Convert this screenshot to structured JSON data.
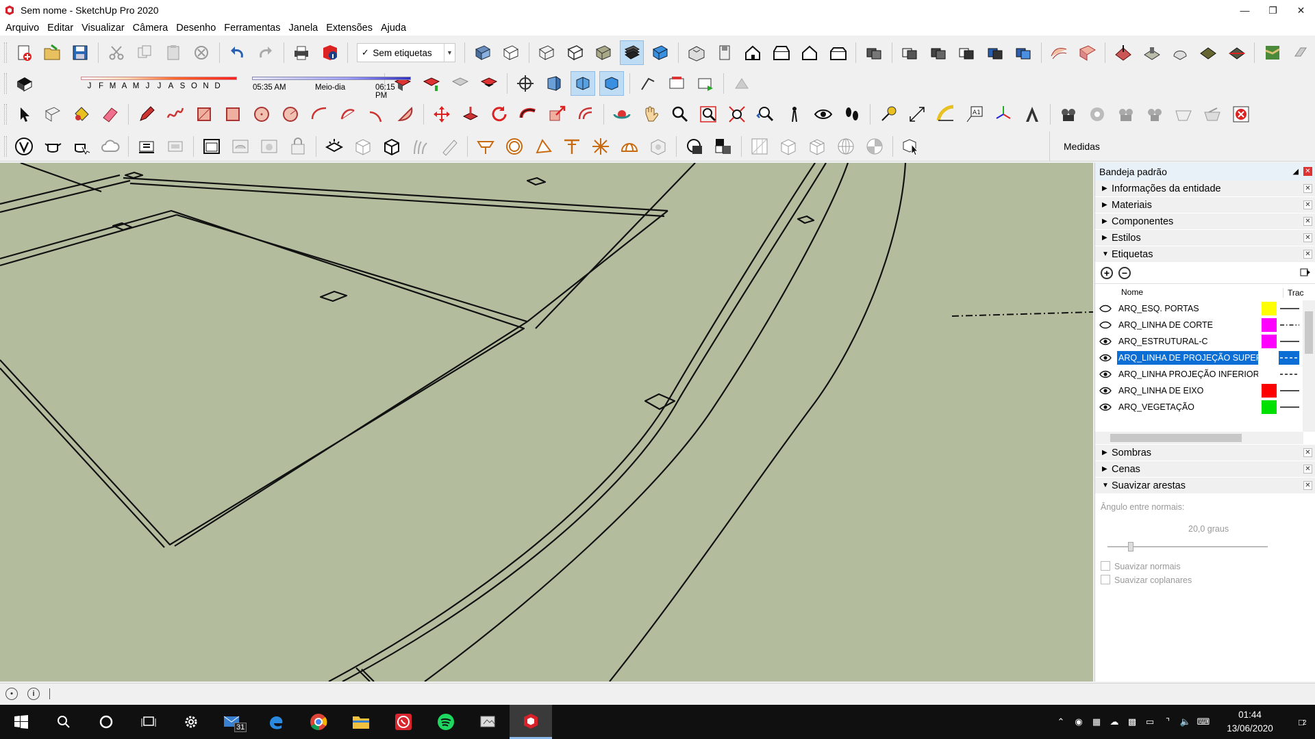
{
  "window": {
    "title": "Sem nome - SketchUp Pro 2020",
    "controls": [
      "minimize",
      "restore",
      "close"
    ]
  },
  "menu": [
    "Arquivo",
    "Editar",
    "Visualizar",
    "Câmera",
    "Desenho",
    "Ferramentas",
    "Janela",
    "Extensões",
    "Ajuda"
  ],
  "toolbar": {
    "tag_select": "Sem etiquetas",
    "months": [
      "J",
      "F",
      "M",
      "A",
      "M",
      "J",
      "J",
      "A",
      "S",
      "O",
      "N",
      "D"
    ],
    "time_start": "05:35 AM",
    "time_mid": "Meio-dia",
    "time_end": "06:15 PM",
    "measures_label": "Medidas"
  },
  "tray": {
    "title": "Bandeja padrão",
    "panels_top": [
      "Informações da entidade",
      "Materiais",
      "Componentes",
      "Estilos",
      "Etiquetas"
    ],
    "tags_header": {
      "name": "Nome",
      "dash": "Trac"
    },
    "tags": [
      {
        "name": "ARQ_ESQ. PORTAS",
        "visible": false,
        "color": "#ffff00",
        "dash": "solid"
      },
      {
        "name": "ARQ_LINHA DE CORTE",
        "visible": false,
        "color": "#ff00ff",
        "dash": "dashdot"
      },
      {
        "name": "ARQ_ESTRUTURAL-C",
        "visible": true,
        "color": "#ff00ff",
        "dash": "solid"
      },
      {
        "name": "ARQ_LINHA DE PROJEÇÃO SUPERIOR",
        "visible": true,
        "color": "#ffffff",
        "dash": "dashed",
        "selected": true
      },
      {
        "name": "ARQ_LINHA PROJEÇÃO INFERIOR",
        "visible": true,
        "color": "#ffffff",
        "dash": "dashed"
      },
      {
        "name": "ARQ_LINHA DE EIXO",
        "visible": true,
        "color": "#ff0000",
        "dash": "solid"
      },
      {
        "name": "ARQ_VEGETAÇÃO",
        "visible": true,
        "color": "#00e000",
        "dash": "solid"
      }
    ],
    "panels_bottom": [
      "Sombras",
      "Cenas",
      "Suavizar arestas"
    ],
    "smooth": {
      "angle_label": "Ângulo entre normais:",
      "angle_value": "20,0  graus",
      "smooth_normals": "Suavizar normais",
      "soften_coplanar": "Suavizar coplanares"
    }
  },
  "taskbar": {
    "mail_badge": "31",
    "time": "01:44",
    "date": "13/06/2020",
    "notifications": "2"
  }
}
